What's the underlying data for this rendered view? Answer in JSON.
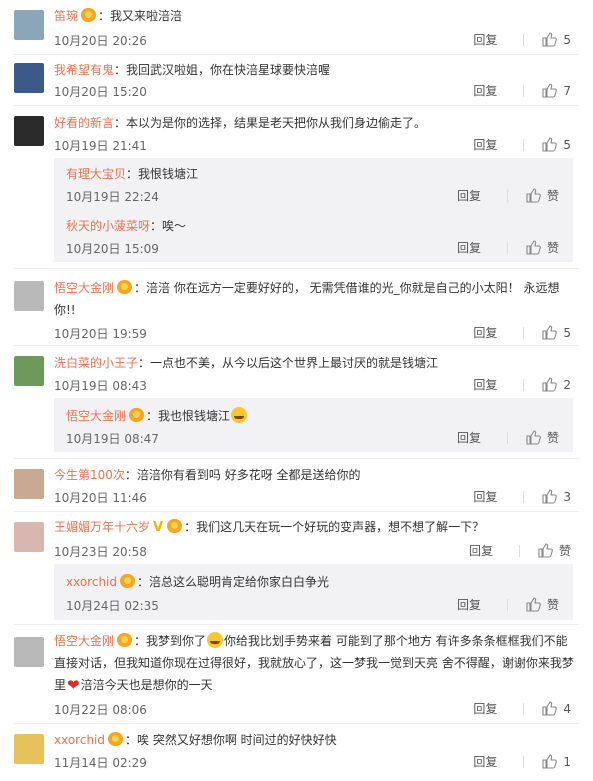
{
  "comments": [
    {
      "name": "笛琬",
      "badge": true,
      "text": "：我又来啦涪涪",
      "time": "10月20日 20:26",
      "reply": "回复",
      "likes": "5",
      "avatar_color": "#8aa6b8"
    },
    {
      "name": "我希望有鬼",
      "badge": false,
      "text": "：我回武汉啦姐，你在快涪星球要快涪喔",
      "time": "10月20日 15:20",
      "reply": "回复",
      "likes": "7",
      "avatar_color": "#3b5a8a"
    },
    {
      "name": "好看的新言",
      "badge": false,
      "text": "：本以为是你的选择，结果是老天把你从我们身边偷走了。",
      "time": "10月19日 21:41",
      "reply": "回复",
      "likes": "5",
      "avatar_color": "#2a2a2a",
      "subs": [
        {
          "name": "有理大宝贝",
          "badge": false,
          "text": "：我恨钱塘江",
          "time": "10月19日 22:24",
          "reply": "回复",
          "likes": "赞"
        },
        {
          "name": "秋天的小菠菜呀",
          "badge": false,
          "text": "：唉～",
          "time": "10月20日 15:09",
          "reply": "回复",
          "likes": "赞"
        }
      ]
    },
    {
      "name": "悟空大金刚",
      "badge": true,
      "text": "：涪涪 你在远方一定要好好的， 无需凭借谁的光_你就是自己的小太阳！ 永远想你!!",
      "time": "10月20日 19:59",
      "reply": "回复",
      "likes": "5",
      "avatar_color": "#b9b9b9"
    },
    {
      "name": "洗白菜的小王子",
      "badge": false,
      "text": "：一点也不美，从今以后这个世界上最讨厌的就是钱塘江",
      "time": "10月19日 08:43",
      "reply": "回复",
      "likes": "2",
      "avatar_color": "#6c9a5a",
      "subs": [
        {
          "name": "悟空大金刚",
          "badge": true,
          "text": "：我也恨钱塘江",
          "time": "10月19日 08:47",
          "reply": "回复",
          "likes": "赞",
          "emoji": true
        }
      ]
    },
    {
      "name": "今生第100次",
      "badge": false,
      "text": "：涪涪你有看到吗 好多花呀 全都是送给你的",
      "time": "10月20日 11:46",
      "reply": "回复",
      "likes": "3",
      "avatar_color": "#c9a98f"
    },
    {
      "name": "王媚媚万年十六岁",
      "badge": false,
      "vip": true,
      "text": "：我们这几天在玩一个好玩的变声器，想不想了解一下？",
      "time": "10月23日 20:58",
      "reply": "回复",
      "likes": "赞",
      "avatar_color": "#d8b7b0",
      "subs": [
        {
          "name": "xxorchid",
          "badge": true,
          "text": "：涪总这么聪明肯定给你家白白争光",
          "time": "10月24日 02:35",
          "reply": "回复",
          "likes": "赞"
        }
      ]
    },
    {
      "name": "悟空大金刚",
      "badge": true,
      "text_parts": [
        "：我梦到你了",
        "你给我比划手势来着 可能到了那个地方 有许多条条框框我们不能直接对话，但我知道你现在过得很好，我就放心了，这一梦我一觉到天亮 舍不得醒，谢谢你来我梦里",
        "涪涪今天也是想你的一天"
      ],
      "time": "10月22日 08:06",
      "reply": "回复",
      "likes": "4",
      "avatar_color": "#b9b9b9"
    },
    {
      "name": "xxorchid",
      "badge": true,
      "text": "：唉 突然又好想你啊 时间过的好快好快",
      "time": "11月14日 02:29",
      "reply": "回复",
      "likes": "1",
      "avatar_color": "#e7c25a"
    }
  ],
  "colors": {
    "name": "#eb7350",
    "text": "#333333",
    "time": "#666666",
    "subbox": "#f2f2f5"
  }
}
